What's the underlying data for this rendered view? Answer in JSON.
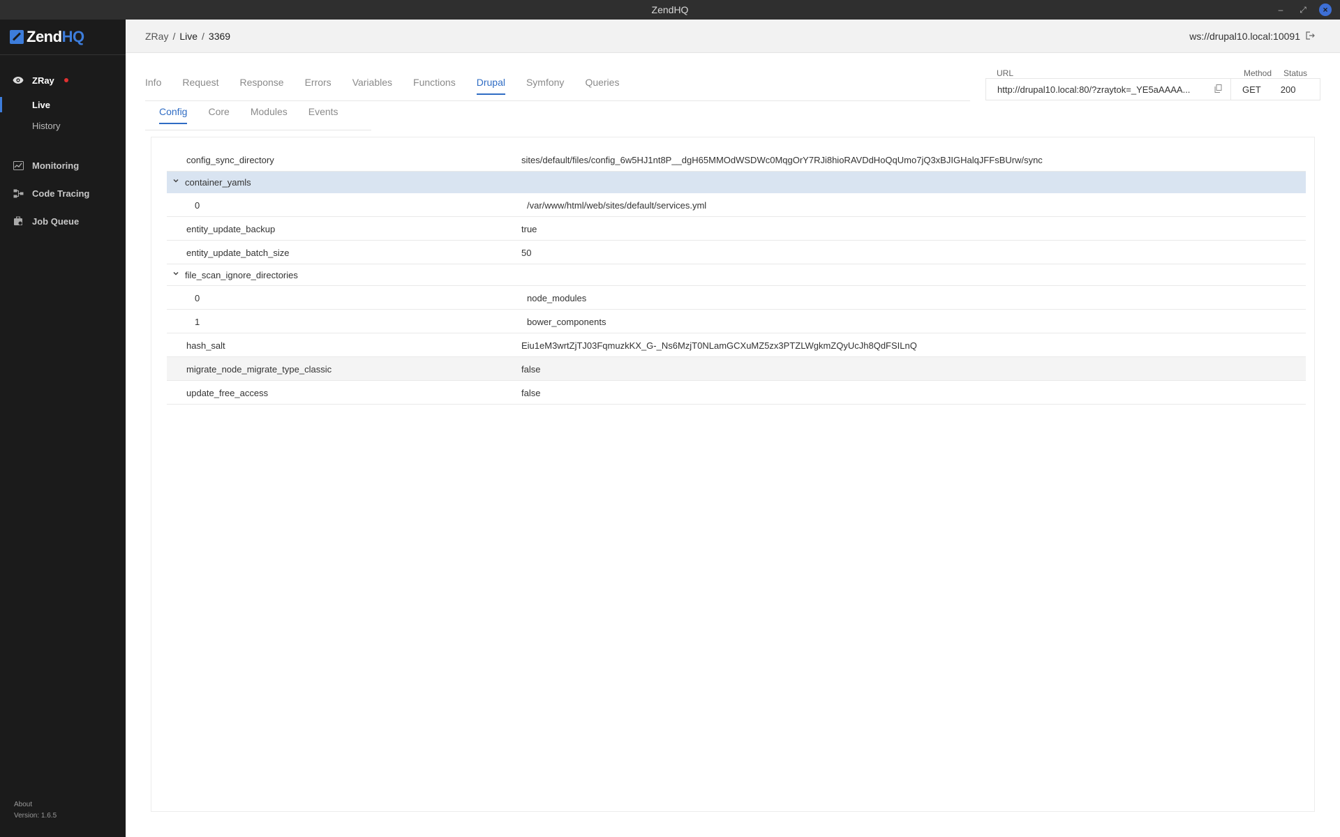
{
  "window": {
    "title": "ZendHQ",
    "min": "–",
    "max": "⤢",
    "close": "×"
  },
  "sidebar": {
    "brand_zend": "Zend",
    "brand_hq": "HQ",
    "zray_label": "ZRay",
    "zray_sub": [
      "Live",
      "History"
    ],
    "items": [
      "Monitoring",
      "Code Tracing",
      "Job Queue"
    ],
    "footer_about": "About",
    "footer_version": "Version: 1.6.5"
  },
  "header": {
    "breadcrumb": [
      "ZRay",
      "/",
      "Live",
      "/",
      "3369"
    ],
    "ws": "ws://drupal10.local:10091"
  },
  "tabs": [
    "Info",
    "Request",
    "Response",
    "Errors",
    "Variables",
    "Functions",
    "Drupal",
    "Symfony",
    "Queries"
  ],
  "active_tab": "Drupal",
  "subtabs": [
    "Config",
    "Core",
    "Modules",
    "Events"
  ],
  "active_subtab": "Config",
  "request": {
    "url_label": "URL",
    "url": "http://drupal10.local:80/?zraytok=_YE5aAAAA...",
    "method_label": "Method",
    "method": "GET",
    "status_label": "Status",
    "status": "200"
  },
  "config_rows": [
    {
      "kind": "row",
      "key": "config_sync_directory",
      "value": "sites/default/files/config_6w5HJ1nt8P__dgH65MMOdWSDWc0MqgOrY7RJi8hioRAVDdHoQqUmo7jQ3xBJIGHalqJFFsBUrw/sync"
    },
    {
      "kind": "group",
      "key": "container_yamls"
    },
    {
      "kind": "child",
      "key": "0",
      "value": "/var/www/html/web/sites/default/services.yml"
    },
    {
      "kind": "row",
      "key": "entity_update_backup",
      "value": "true"
    },
    {
      "kind": "row",
      "key": "entity_update_batch_size",
      "value": "50"
    },
    {
      "kind": "group",
      "key": "file_scan_ignore_directories"
    },
    {
      "kind": "child",
      "key": "0",
      "value": "node_modules"
    },
    {
      "kind": "child",
      "key": "1",
      "value": "bower_components"
    },
    {
      "kind": "row",
      "key": "hash_salt",
      "value": "Eiu1eM3wrtZjTJ03FqmuzkKX_G-_Ns6MzjT0NLamGCXuMZ5zx3PTZLWgkmZQyUcJh8QdFSILnQ"
    },
    {
      "kind": "row",
      "key": "migrate_node_migrate_type_classic",
      "value": "false"
    },
    {
      "kind": "row",
      "key": "update_free_access",
      "value": "false"
    }
  ]
}
